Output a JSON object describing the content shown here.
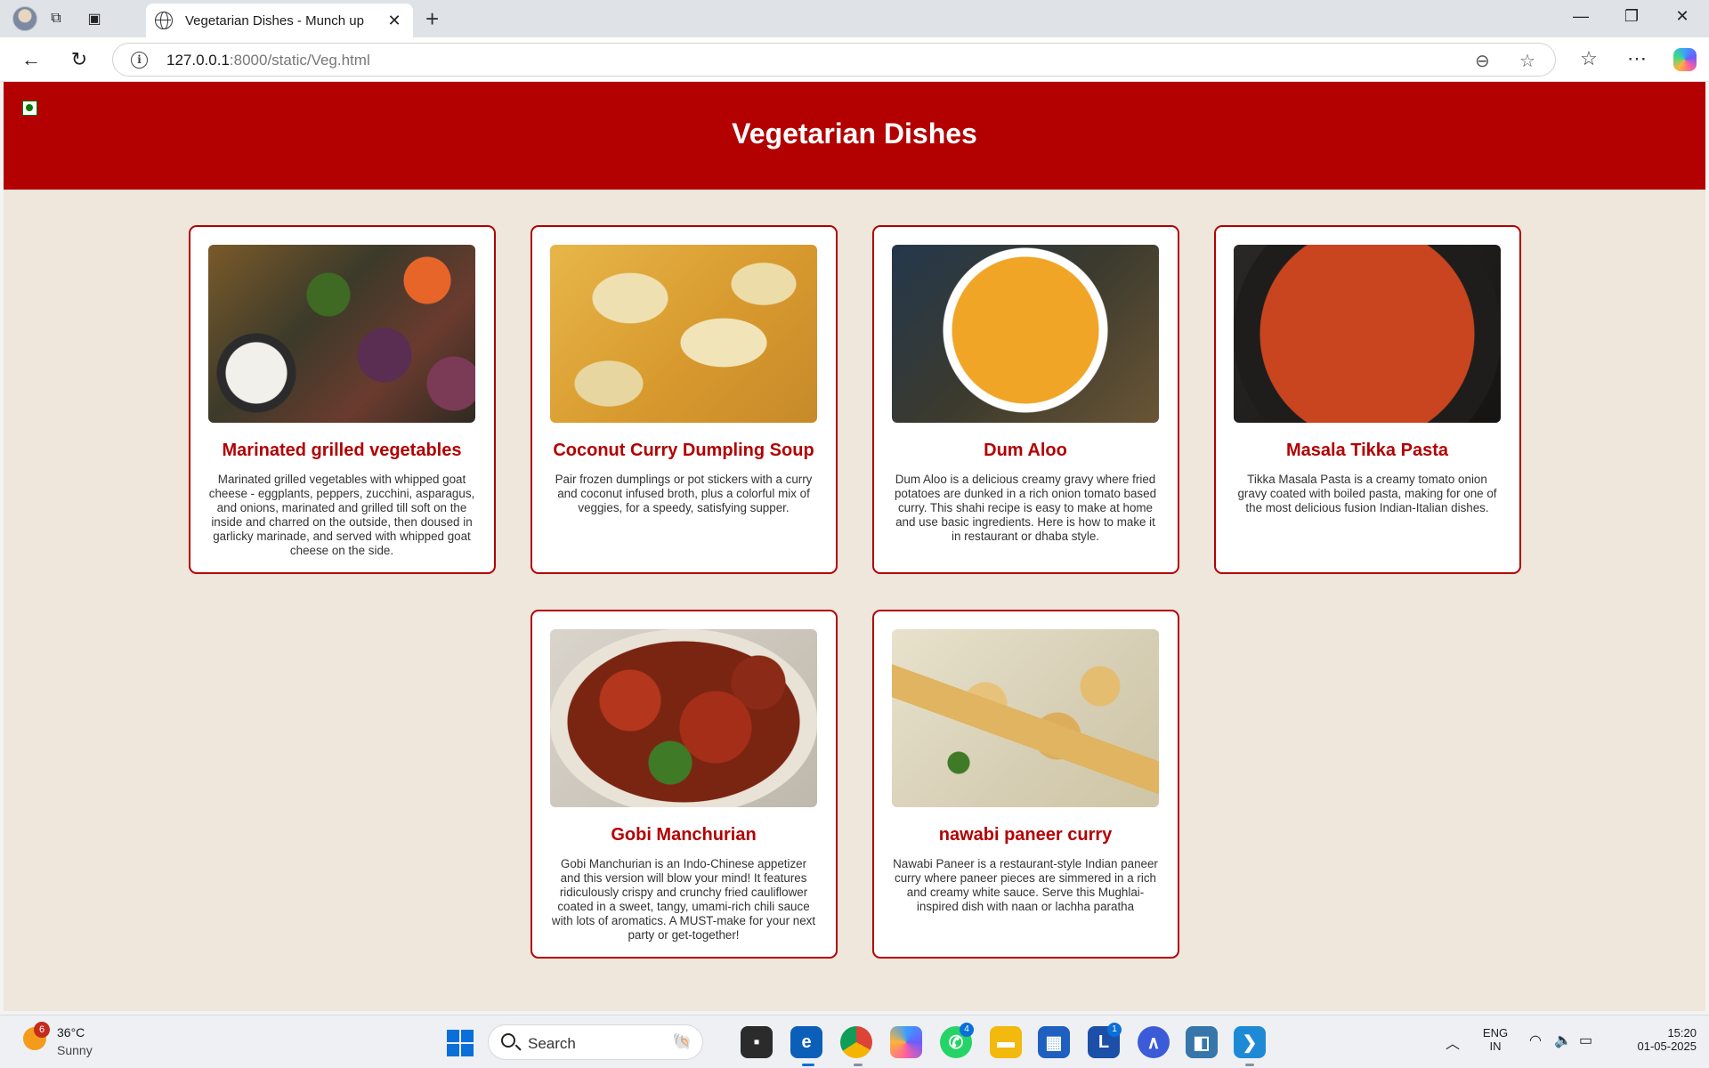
{
  "browser": {
    "tab_title": "Vegetarian Dishes - Munch up",
    "tab_close": "✕",
    "new_tab": "+",
    "url_host": "127.0.0.1",
    "url_rest": ":8000/static/Veg.html",
    "window_min": "—",
    "window_restore": "❐",
    "window_close": "✕"
  },
  "page": {
    "title": "Vegetarian Dishes"
  },
  "dishes": [
    {
      "title": "Marinated grilled vegetables",
      "desc": "Marinated grilled vegetables with whipped goat cheese - eggplants, peppers, zucchini, asparagus, and onions, marinated and grilled till soft on the inside and charred on the outside, then doused in garlicky marinade, and served with whipped goat cheese on the side."
    },
    {
      "title": "Coconut Curry Dumpling Soup",
      "desc": "Pair frozen dumplings or pot stickers with a curry and coconut infused broth, plus a colorful mix of veggies, for a speedy, satisfying supper."
    },
    {
      "title": "Dum Aloo",
      "desc": "Dum Aloo is a delicious creamy gravy where fried potatoes are dunked in a rich onion tomato based curry. This shahi recipe is easy to make at home and use basic ingredients. Here is how to make it in restaurant or dhaba style."
    },
    {
      "title": "Masala Tikka Pasta",
      "desc": "Tikka Masala Pasta is a creamy tomato onion gravy coated with boiled pasta, making for one of the most delicious fusion Indian-Italian dishes."
    },
    {
      "title": "Gobi Manchurian",
      "desc": "Gobi Manchurian is an Indo-Chinese appetizer and this version will blow your mind! It features ridiculously crispy and crunchy fried cauliflower coated in a sweet, tangy, umami-rich chili sauce with lots of aromatics. A MUST-make for your next party or get-together!"
    },
    {
      "title": "nawabi paneer curry",
      "desc": "Nawabi Paneer is a restaurant-style Indian paneer curry where paneer pieces are simmered in a rich and creamy white sauce. Serve this Mughlai-inspired dish with naan or lachha paratha"
    }
  ],
  "taskbar": {
    "weather_badge": "6",
    "weather_temp": "36°C",
    "weather_cond": "Sunny",
    "search_placeholder": "Search",
    "whatsapp_badge": "4",
    "l_app_label": "L",
    "l_app_badge": "1",
    "lang_top": "ENG",
    "lang_bottom": "IN",
    "time": "15:20",
    "date": "01-05-2025"
  },
  "colors": {
    "header_red": "#b30000",
    "page_bg": "#efe6dc",
    "card_border": "#b30000",
    "title_red": "#b30000"
  }
}
